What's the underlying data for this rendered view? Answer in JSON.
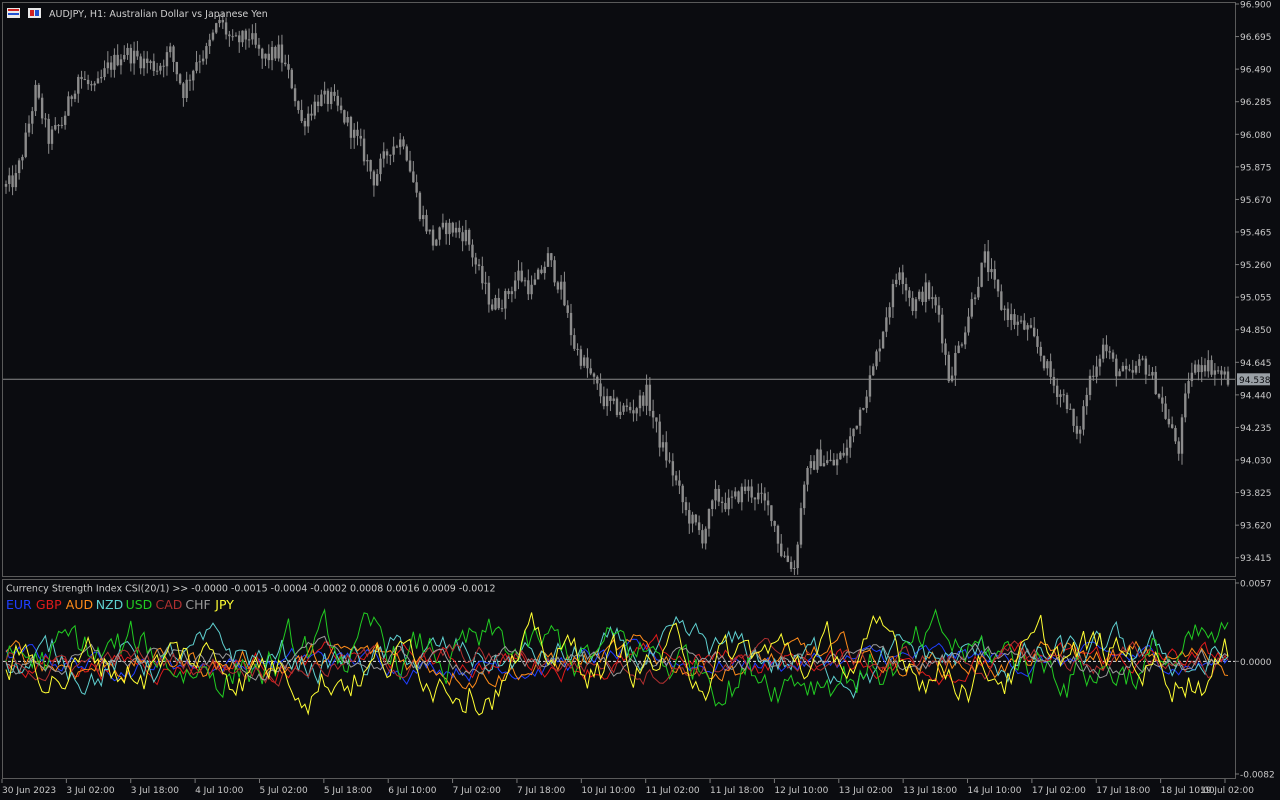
{
  "window": {
    "symbol_title": "AUDJPY, H1:  Australian Dollar vs Japanese Yen",
    "icons": [
      "flag-icon",
      "one-click-trading-icon"
    ]
  },
  "price_panel": {
    "current_price": "94.538",
    "price_ticks": [
      "96.900",
      "96.695",
      "96.490",
      "96.285",
      "96.080",
      "95.875",
      "95.670",
      "95.465",
      "95.260",
      "95.055",
      "94.850",
      "94.645",
      "94.440",
      "94.235",
      "94.030",
      "93.825",
      "93.620",
      "93.415"
    ]
  },
  "indicator_panel": {
    "title": "Currency Strength Index CSI(20/1) >> -0.0000 -0.0015 -0.0004 -0.0002 0.0008 0.0016 0.0009 -0.0012",
    "ticks": [
      "0.0057",
      "0.0000",
      "-0.0082"
    ],
    "legend": [
      {
        "name": "EUR",
        "color": "#1f3fff"
      },
      {
        "name": "GBP",
        "color": "#e01b1b"
      },
      {
        "name": "AUD",
        "color": "#ff8c1a"
      },
      {
        "name": "NZD",
        "color": "#5fd0d0"
      },
      {
        "name": "USD",
        "color": "#22cc22"
      },
      {
        "name": "CAD",
        "color": "#b03030"
      },
      {
        "name": "CHF",
        "color": "#9a9a9a"
      },
      {
        "name": "JPY",
        "color": "#ffff33"
      }
    ]
  },
  "time_axis": [
    "30 Jun 2023",
    "3 Jul 02:00",
    "3 Jul 18:00",
    "4 Jul 10:00",
    "5 Jul 02:00",
    "5 Jul 18:00",
    "6 Jul 10:00",
    "7 Jul 02:00",
    "7 Jul 18:00",
    "10 Jul 10:00",
    "11 Jul 02:00",
    "11 Jul 18:00",
    "12 Jul 10:00",
    "13 Jul 02:00",
    "13 Jul 18:00",
    "14 Jul 10:00",
    "17 Jul 02:00",
    "17 Jul 18:00",
    "18 Jul 10:00",
    "19 Jul 02:00"
  ],
  "chart_data": {
    "type": "candlestick",
    "title": "AUDJPY, H1:  Australian Dollar vs Japanese Yen",
    "ylim": [
      93.3,
      96.9
    ],
    "anchors": [
      [
        0,
        95.75
      ],
      [
        3,
        95.8
      ],
      [
        6,
        96.05
      ],
      [
        9,
        96.35
      ],
      [
        13,
        96.05
      ],
      [
        17,
        96.15
      ],
      [
        22,
        96.45
      ],
      [
        27,
        96.35
      ],
      [
        31,
        96.5
      ],
      [
        36,
        96.6
      ],
      [
        41,
        96.55
      ],
      [
        46,
        96.5
      ],
      [
        50,
        96.6
      ],
      [
        54,
        96.35
      ],
      [
        58,
        96.55
      ],
      [
        61,
        96.6
      ],
      [
        65,
        96.8
      ],
      [
        69,
        96.65
      ],
      [
        74,
        96.7
      ],
      [
        78,
        96.55
      ],
      [
        83,
        96.6
      ],
      [
        87,
        96.4
      ],
      [
        90,
        96.15
      ],
      [
        95,
        96.3
      ],
      [
        99,
        96.3
      ],
      [
        104,
        96.15
      ],
      [
        108,
        96.0
      ],
      [
        112,
        95.8
      ],
      [
        117,
        96.0
      ],
      [
        121,
        96.05
      ],
      [
        126,
        95.6
      ],
      [
        130,
        95.4
      ],
      [
        134,
        95.5
      ],
      [
        140,
        95.45
      ],
      [
        144,
        95.2
      ],
      [
        148,
        95.0
      ],
      [
        152,
        95.05
      ],
      [
        156,
        95.2
      ],
      [
        160,
        95.1
      ],
      [
        165,
        95.3
      ],
      [
        169,
        95.1
      ],
      [
        173,
        94.75
      ],
      [
        177,
        94.6
      ],
      [
        182,
        94.4
      ],
      [
        186,
        94.35
      ],
      [
        191,
        94.35
      ],
      [
        195,
        94.45
      ],
      [
        199,
        94.15
      ],
      [
        203,
        93.95
      ],
      [
        207,
        93.7
      ],
      [
        212,
        93.55
      ],
      [
        216,
        93.8
      ],
      [
        220,
        93.75
      ],
      [
        225,
        93.85
      ],
      [
        229,
        93.8
      ],
      [
        233,
        93.7
      ],
      [
        236,
        93.45
      ],
      [
        240,
        93.35
      ],
      [
        243,
        93.9
      ],
      [
        247,
        94.05
      ],
      [
        252,
        94.0
      ],
      [
        256,
        94.1
      ],
      [
        260,
        94.35
      ],
      [
        264,
        94.6
      ],
      [
        268,
        94.95
      ],
      [
        272,
        95.25
      ],
      [
        276,
        95.0
      ],
      [
        280,
        95.1
      ],
      [
        284,
        94.95
      ],
      [
        287,
        94.55
      ],
      [
        291,
        94.8
      ],
      [
        295,
        95.1
      ],
      [
        298,
        95.3
      ],
      [
        303,
        95.0
      ],
      [
        307,
        94.9
      ],
      [
        311,
        94.85
      ],
      [
        315,
        94.7
      ],
      [
        319,
        94.5
      ],
      [
        323,
        94.4
      ],
      [
        326,
        94.15
      ],
      [
        330,
        94.55
      ],
      [
        334,
        94.75
      ],
      [
        338,
        94.6
      ],
      [
        342,
        94.55
      ],
      [
        346,
        94.65
      ],
      [
        350,
        94.5
      ],
      [
        354,
        94.25
      ],
      [
        357,
        94.1
      ],
      [
        360,
        94.55
      ],
      [
        364,
        94.65
      ],
      [
        368,
        94.6
      ],
      [
        372,
        94.54
      ]
    ],
    "volatility": 0.055
  },
  "csi_data": {
    "type": "line",
    "ylim": [
      -0.0082,
      0.0057
    ],
    "series": [
      {
        "name": "EUR",
        "color": "#1f3fff"
      },
      {
        "name": "GBP",
        "color": "#e01b1b"
      },
      {
        "name": "AUD",
        "color": "#ff8c1a"
      },
      {
        "name": "NZD",
        "color": "#5fd0d0"
      },
      {
        "name": "USD",
        "color": "#22cc22"
      },
      {
        "name": "CAD",
        "color": "#b03030"
      },
      {
        "name": "CHF",
        "color": "#9a9a9a"
      },
      {
        "name": "JPY",
        "color": "#ffff33"
      }
    ]
  }
}
